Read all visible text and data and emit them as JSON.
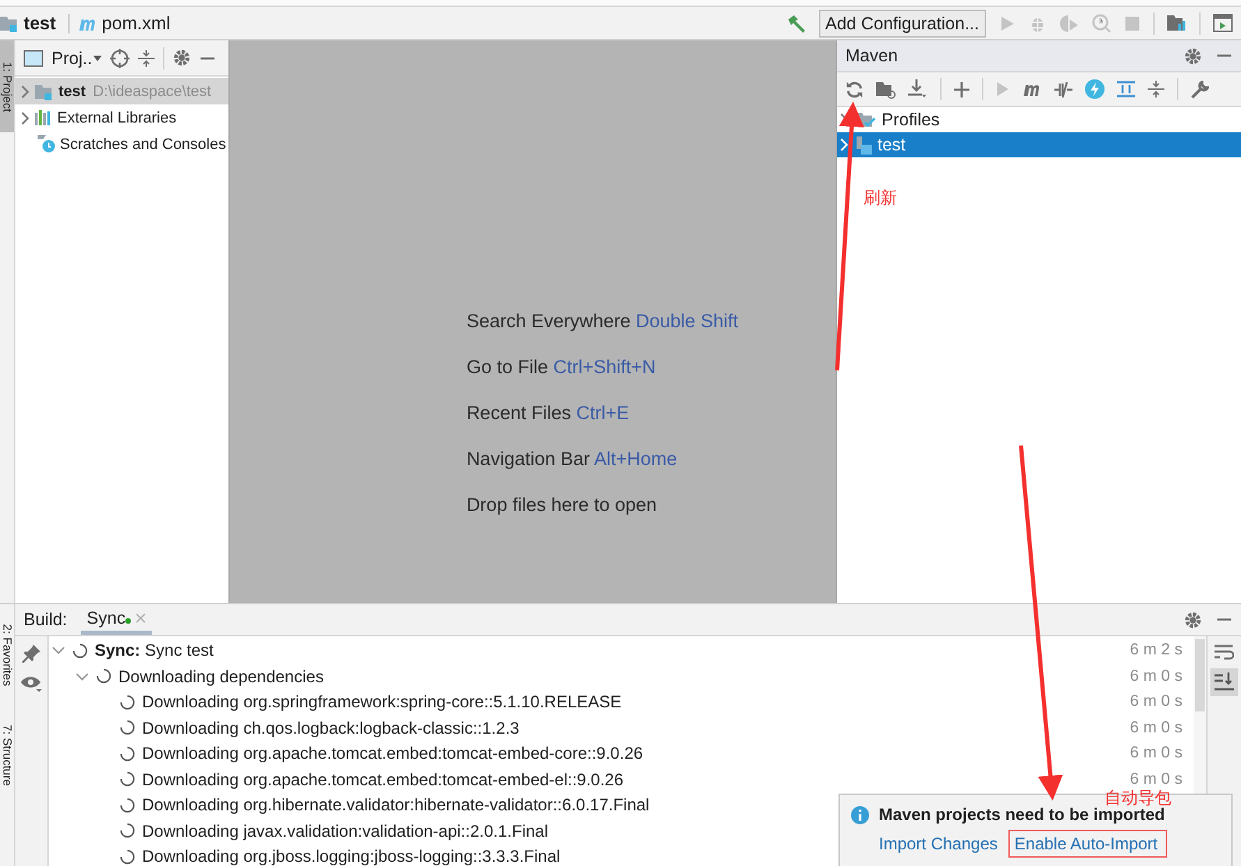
{
  "breadcrumb": [
    {
      "label": "test",
      "kind": "folder"
    },
    {
      "label": "pom.xml",
      "kind": "maven"
    }
  ],
  "toolbar": {
    "config_button": "Add Configuration..."
  },
  "tool_strip": {
    "top": [
      "1: Project"
    ],
    "bottom": [
      "2: Favorites",
      "7: Structure"
    ]
  },
  "project_panel": {
    "title": "Proj..",
    "tree": [
      {
        "label": "test",
        "path": "D:\\ideaspace\\test",
        "kind": "module",
        "expanded": false,
        "selected": true
      },
      {
        "label": "External Libraries",
        "kind": "library",
        "expanded": false,
        "selected": false
      },
      {
        "label": "Scratches and Consoles",
        "kind": "scratch",
        "selected": false
      }
    ]
  },
  "editor_hints": [
    {
      "action": "Search Everywhere",
      "shortcut": "Double Shift"
    },
    {
      "action": "Go to File",
      "shortcut": "Ctrl+Shift+N"
    },
    {
      "action": "Recent Files",
      "shortcut": "Ctrl+E"
    },
    {
      "action": "Navigation Bar",
      "shortcut": "Alt+Home"
    },
    {
      "action": "Drop files here to open"
    }
  ],
  "maven_panel": {
    "title": "Maven",
    "tree": [
      {
        "label": "Profiles",
        "kind": "profiles",
        "expanded": false,
        "selected": false
      },
      {
        "label": "test",
        "kind": "project",
        "expanded": false,
        "selected": true
      }
    ]
  },
  "build_panel": {
    "label": "Build:",
    "tabs": [
      {
        "label": "Sync",
        "selected": true
      }
    ],
    "tree": [
      {
        "label": "**Sync:** Sync test",
        "time": "6 m 2 s",
        "expanded": true,
        "children": [
          {
            "label": "Downloading dependencies",
            "time": "6 m 0 s",
            "expanded": true,
            "children": [
              {
                "label": "Downloading org.springframework:spring-core::5.1.10.RELEASE",
                "time": "6 m 0 s"
              },
              {
                "label": "Downloading ch.qos.logback:logback-classic::1.2.3",
                "time": "6 m 0 s"
              },
              {
                "label": "Downloading org.apache.tomcat.embed:tomcat-embed-core::9.0.26",
                "time": "6 m 0 s"
              },
              {
                "label": "Downloading org.apache.tomcat.embed:tomcat-embed-el::9.0.26",
                "time": "6 m 0 s"
              },
              {
                "label": "Downloading org.hibernate.validator:hibernate-validator::6.0.17.Final"
              },
              {
                "label": "Downloading javax.validation:validation-api::2.0.1.Final"
              },
              {
                "label": "Downloading org.jboss.logging:jboss-logging::3.3.3.Final"
              }
            ]
          }
        ]
      }
    ]
  },
  "notification": {
    "title": "Maven projects need to be imported",
    "links": [
      {
        "label": "Import Changes",
        "highlighted": false
      },
      {
        "label": "Enable Auto-Import",
        "highlighted": true
      }
    ]
  },
  "annotations": [
    {
      "text": "刷新"
    },
    {
      "text": "自动导包"
    }
  ]
}
